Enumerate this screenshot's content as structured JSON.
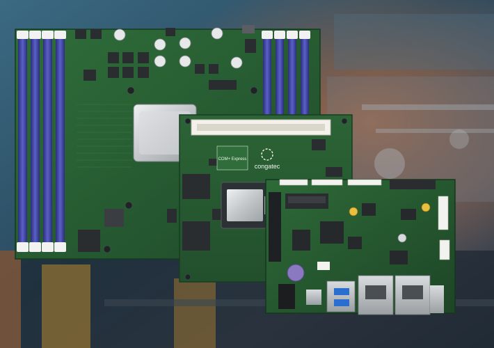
{
  "logos": {
    "com_express": "COM+ Express",
    "congatec": "congatec"
  },
  "colors": {
    "background_blue": "#2a4a60",
    "background_orange": "#c4703e",
    "pcb_green_dark": "#1f4a2a",
    "pcb_green": "#2e6a38",
    "dimm_slot_blue": "#3a3f9a",
    "heatspreader_silver": "#cfd3d6",
    "usb_blue": "#2a6fd0"
  }
}
